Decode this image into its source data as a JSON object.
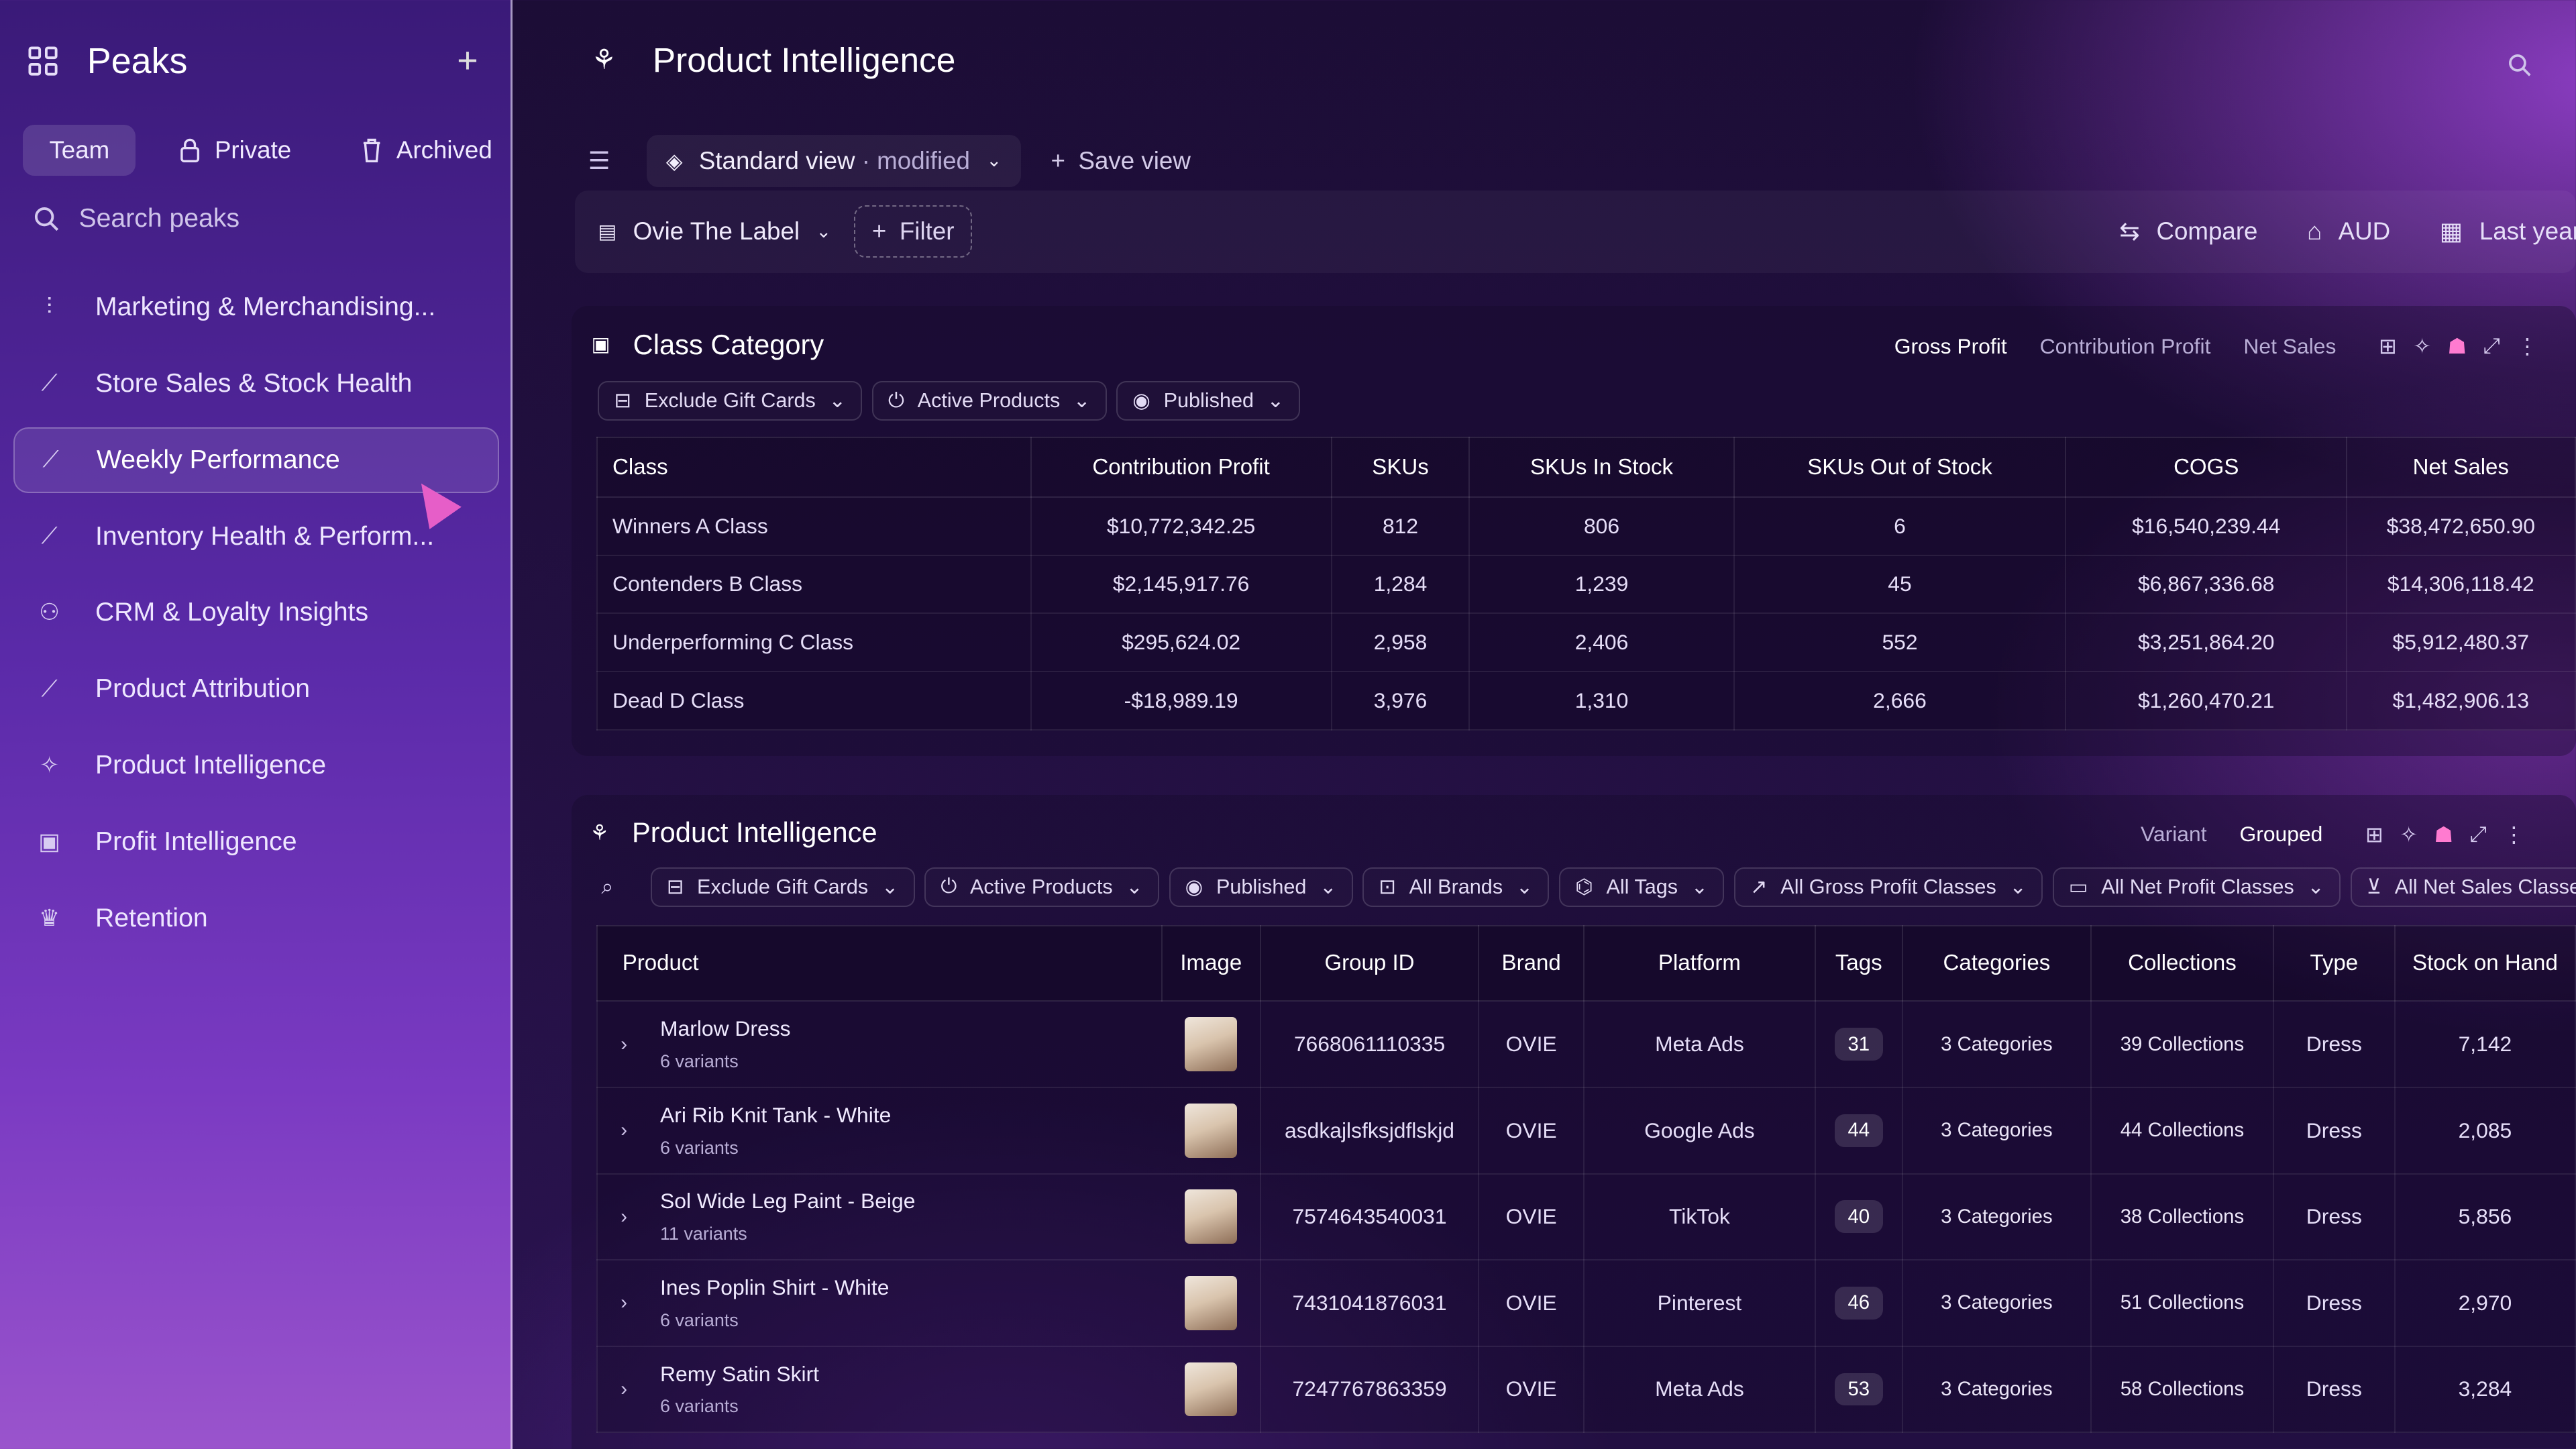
{
  "sidebar": {
    "title": "Peaks",
    "tabs": [
      {
        "label": "Team",
        "icon": ""
      },
      {
        "label": "Private",
        "icon": "lock-icon"
      },
      {
        "label": "Archived",
        "icon": "archive-icon"
      }
    ],
    "search_placeholder": "Search peaks",
    "items": [
      {
        "label": "Marketing & Merchandising...",
        "icon": "chart-icon"
      },
      {
        "label": "Store Sales & Stock Health",
        "icon": "line-chart-icon"
      },
      {
        "label": "Weekly Performance",
        "icon": "line-chart-icon"
      },
      {
        "label": "Inventory Health & Perform...",
        "icon": "line-chart-icon"
      },
      {
        "label": "CRM & Loyalty Insights",
        "icon": "user-icon"
      },
      {
        "label": "Product Attribution",
        "icon": "line-chart-icon"
      },
      {
        "label": "Product Intelligence",
        "icon": "sparkle-icon"
      },
      {
        "label": "Profit Intelligence",
        "icon": "money-icon"
      },
      {
        "label": "Retention",
        "icon": "crown-icon"
      }
    ]
  },
  "header": {
    "title": "Product Intelligence"
  },
  "viewbar": {
    "view_name": "Standard view",
    "modifier": "· modified",
    "save_label": "Save view"
  },
  "filterbar": {
    "store": "Ovie The Label",
    "filter_label": "Filter",
    "compare": "Compare",
    "currency": "AUD",
    "period": "Last year"
  },
  "class_panel": {
    "title": "Class Category",
    "metrics": [
      "Gross Profit",
      "Contribution Profit",
      "Net Sales"
    ],
    "chips": [
      "Exclude Gift Cards",
      "Active Products",
      "Published"
    ],
    "columns": [
      "Class",
      "Contribution Profit",
      "SKUs",
      "SKUs In Stock",
      "SKUs Out of Stock",
      "COGS",
      "Net Sales"
    ],
    "rows": [
      [
        "Winners A Class",
        "$10,772,342.25",
        "812",
        "806",
        "6",
        "$16,540,239.44",
        "$38,472,650.90"
      ],
      [
        "Contenders B Class",
        "$2,145,917.76",
        "1,284",
        "1,239",
        "45",
        "$6,867,336.68",
        "$14,306,118.42"
      ],
      [
        "Underperforming C Class",
        "$295,624.02",
        "2,958",
        "2,406",
        "552",
        "$3,251,864.20",
        "$5,912,480.37"
      ],
      [
        "Dead D Class",
        "-$18,989.19",
        "3,976",
        "1,310",
        "2,666",
        "$1,260,470.21",
        "$1,482,906.13"
      ]
    ]
  },
  "product_panel": {
    "title": "Product Intelligence",
    "modes": [
      "Variant",
      "Grouped"
    ],
    "chips": [
      "Exclude Gift Cards",
      "Active Products",
      "Published",
      "All Brands",
      "All Tags",
      "All Gross Profit Classes",
      "All Net Profit Classes",
      "All Net Sales Classes"
    ],
    "columns": [
      "Product",
      "Image",
      "Group ID",
      "Brand",
      "Platform",
      "Tags",
      "Categories",
      "Collections",
      "Type",
      "Stock on Hand"
    ],
    "rows": [
      {
        "name": "Marlow Dress",
        "variants": "6 variants",
        "group_id": "7668061110335",
        "brand": "OVIE",
        "platform": "Meta Ads",
        "tags": "31",
        "categories": "3 Categories",
        "collections": "39 Collections",
        "type": "Dress",
        "stock": "7,142"
      },
      {
        "name": "Ari Rib Knit Tank - White",
        "variants": "6 variants",
        "group_id": "asdkajlsfksjdflskjd",
        "brand": "OVIE",
        "platform": "Google Ads",
        "tags": "44",
        "categories": "3 Categories",
        "collections": "44 Collections",
        "type": "Dress",
        "stock": "2,085"
      },
      {
        "name": "Sol Wide Leg Paint - Beige",
        "variants": "11 variants",
        "group_id": "7574643540031",
        "brand": "OVIE",
        "platform": "TikTok",
        "tags": "40",
        "categories": "3 Categories",
        "collections": "38 Collections",
        "type": "Dress",
        "stock": "5,856"
      },
      {
        "name": "Ines Poplin Shirt - White",
        "variants": "6 variants",
        "group_id": "7431041876031",
        "brand": "OVIE",
        "platform": "Pinterest",
        "tags": "46",
        "categories": "3 Categories",
        "collections": "51 Collections",
        "type": "Dress",
        "stock": "2,970"
      },
      {
        "name": "Remy Satin Skirt",
        "variants": "6 variants",
        "group_id": "7247767863359",
        "brand": "OVIE",
        "platform": "Meta Ads",
        "tags": "53",
        "categories": "3 Categories",
        "collections": "58 Collections",
        "type": "Dress",
        "stock": "3,284"
      }
    ]
  }
}
